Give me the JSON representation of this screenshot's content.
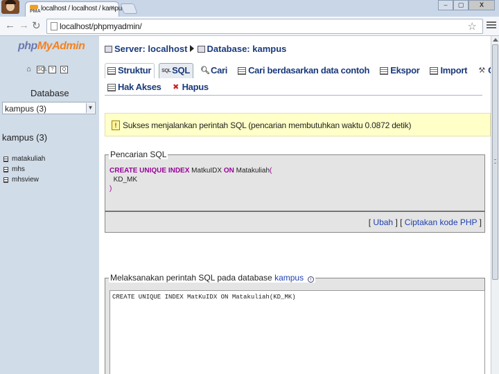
{
  "browser": {
    "tab_title": "localhost / localhost / kampus",
    "tab_close": "×",
    "url": "localhost/phpmyadmin/",
    "window_buttons": {
      "minimize": "–",
      "maximize": "▢",
      "close": "X"
    }
  },
  "left_panel": {
    "logo": {
      "php": "php",
      "my": "My",
      "admin": "Admin"
    },
    "database_label": "Database",
    "database_select_value": "kampus (3)",
    "database_heading": "kampus (3)",
    "tables": [
      "matakuliah",
      "mhs",
      "mhsview"
    ]
  },
  "main": {
    "breadcrumb": {
      "server": "Server: localhost",
      "database": "Database: kampus"
    },
    "tabs_row1": [
      {
        "label": "Struktur",
        "icon": "table-icon"
      },
      {
        "label": "SQL",
        "icon": "sql-icon"
      },
      {
        "label": "Cari",
        "icon": "search-icon"
      },
      {
        "label": "Cari berdasarkan data contoh",
        "icon": "query-icon"
      },
      {
        "label": "Ekspor",
        "icon": "export-icon"
      },
      {
        "label": "Import",
        "icon": "import-icon"
      },
      {
        "label": "Operasi",
        "icon": "operations-icon"
      }
    ],
    "tabs_row2": [
      {
        "label": "Hak Akses",
        "icon": "privileges-icon"
      },
      {
        "label": "Hapus",
        "icon": "drop-icon"
      }
    ],
    "success_message": "Sukses menjalankan perintah SQL (pencarian membutuhkan waktu 0.0872 detik)",
    "sql_query_box": {
      "legend": "Pencarian SQL",
      "line1_kw": "CREATE UNIQUE INDEX",
      "line1_name": "MatkuIDX",
      "line1_on": "ON",
      "line1_table": "Matakuliah",
      "line1_paren": "(",
      "line2": "KD_MK",
      "line3": ")"
    },
    "actions": {
      "open": "[",
      "edit": "Ubah",
      "mid": "] [",
      "php_code": "Ciptakan kode PHP",
      "close": "]"
    },
    "run_box": {
      "legend_prefix": "Melaksanakan perintah SQL pada database",
      "legend_db": "kampus",
      "textarea_value": "CREATE UNIQUE INDEX MatKuIDX ON Matakuliah(KD_MK)"
    }
  },
  "colors": {
    "left_panel_bg": "#d0dce8",
    "link": "#2040b0",
    "sql_keyword": "#990099",
    "success_bg": "#ffffc8"
  }
}
